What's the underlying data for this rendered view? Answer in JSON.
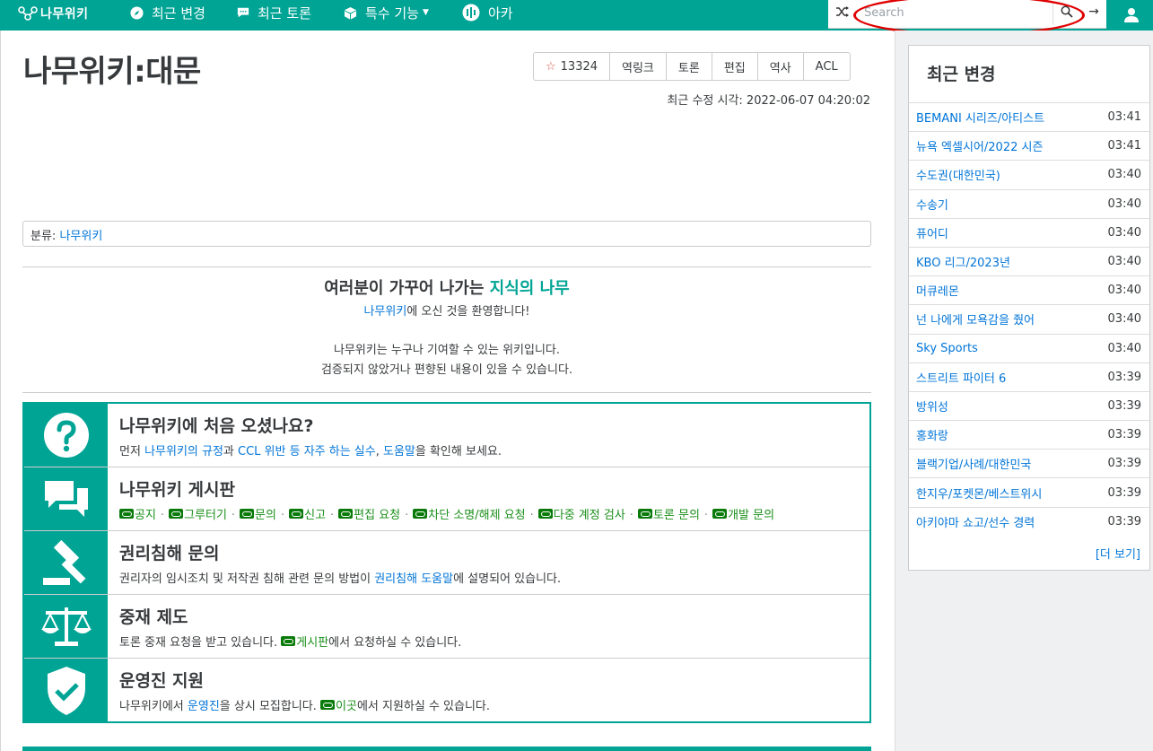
{
  "nav": {
    "logo": "나무위키",
    "items": [
      {
        "label": "최근 변경",
        "icon": "compass-icon"
      },
      {
        "label": "최근 토론",
        "icon": "chat-bubble-icon"
      },
      {
        "label": "특수 기능",
        "icon": "cube-icon",
        "dropdown": true
      },
      {
        "label": "아카",
        "icon": "arca-icon"
      }
    ],
    "search_placeholder": "Search",
    "go_label": "→"
  },
  "page": {
    "title": "나무위키:대문",
    "star_count": "13324",
    "tools": [
      "역링크",
      "토론",
      "편집",
      "역사",
      "ACL"
    ],
    "last_modified": "최근 수정 시각: 2022-06-07 04:20:02",
    "category_label": "분류:",
    "category_value": "나무위키"
  },
  "welcome": {
    "title_pre": "여러분이 가꾸어 나가는 ",
    "title_hl": "지식의 나무",
    "sub_link": "나무위키",
    "sub_rest": "에 오신 것을 환영합니다!",
    "line1": "나무위키는 누구나 기여할 수 있는 위키입니다.",
    "line2": "검증되지 않았거나 편향된 내용이 있을 수 있습니다."
  },
  "panel": {
    "rows": [
      {
        "icon": "question-icon",
        "title": "나무위키에 처음 오셨나요?",
        "d1": "먼저 ",
        "l1": "나무위키의 규정",
        "d2": "과 ",
        "l2": "CCL 위반 등 자주 하는 실수",
        "d3": ", ",
        "l3": "도움말",
        "d4": "을 확인해 보세요."
      },
      {
        "icon": "forum-icon",
        "title": "나무위키 게시판",
        "boards": [
          "공지",
          "그루터기",
          "문의",
          "신고",
          "편집 요청",
          "차단 소명/해제 요청",
          "다중 계정 검사",
          "토론 문의",
          "개발 문의"
        ]
      },
      {
        "icon": "gavel-icon",
        "title": "권리침해 문의",
        "d1": "권리자의 임시조치 및 저작권 침해 관련 문의 방법이 ",
        "l1": "권리침해 도움말",
        "d2": "에 설명되어 있습니다."
      },
      {
        "icon": "scale-icon",
        "title": "중재 제도",
        "d1": "토론 중재 요청을 받고 있습니다. ",
        "l1": "게시판",
        "d2": "에서 요청하실 수 있습니다."
      },
      {
        "icon": "shield-check-icon",
        "title": "운영진 지원",
        "d1": "나무위키에서 ",
        "l1": "운영진",
        "d2": "을 상시 모집합니다. ",
        "l2": "이곳",
        "d3": "에서 지원하실 수 있습니다."
      }
    ]
  },
  "recent_changes": {
    "title": "최근 변경",
    "items": [
      {
        "name": "BEMANI 시리즈/아티스트",
        "time": "03:41"
      },
      {
        "name": "뉴욕 엑셀시어/2022 시즌",
        "time": "03:41"
      },
      {
        "name": "수도권(대한민국)",
        "time": "03:40"
      },
      {
        "name": "수송기",
        "time": "03:40"
      },
      {
        "name": "퓨어디",
        "time": "03:40"
      },
      {
        "name": "KBO 리그/2023년",
        "time": "03:40"
      },
      {
        "name": "머큐레몬",
        "time": "03:40"
      },
      {
        "name": "넌 나에게 모욕감을 줬어",
        "time": "03:40"
      },
      {
        "name": "Sky Sports",
        "time": "03:40"
      },
      {
        "name": "스트리트 파이터 6",
        "time": "03:39"
      },
      {
        "name": "방위성",
        "time": "03:39"
      },
      {
        "name": "홍화랑",
        "time": "03:39"
      },
      {
        "name": "블랙기업/사례/대한민국",
        "time": "03:39"
      },
      {
        "name": "한지우/포켓몬/베스트위시",
        "time": "03:39"
      },
      {
        "name": "아키야마 쇼고/선수 경력",
        "time": "03:39"
      }
    ],
    "more": "[더 보기]"
  },
  "colors": {
    "brand": "#00a495",
    "link": "#0275d8",
    "board_link": "#1a8f1a"
  }
}
